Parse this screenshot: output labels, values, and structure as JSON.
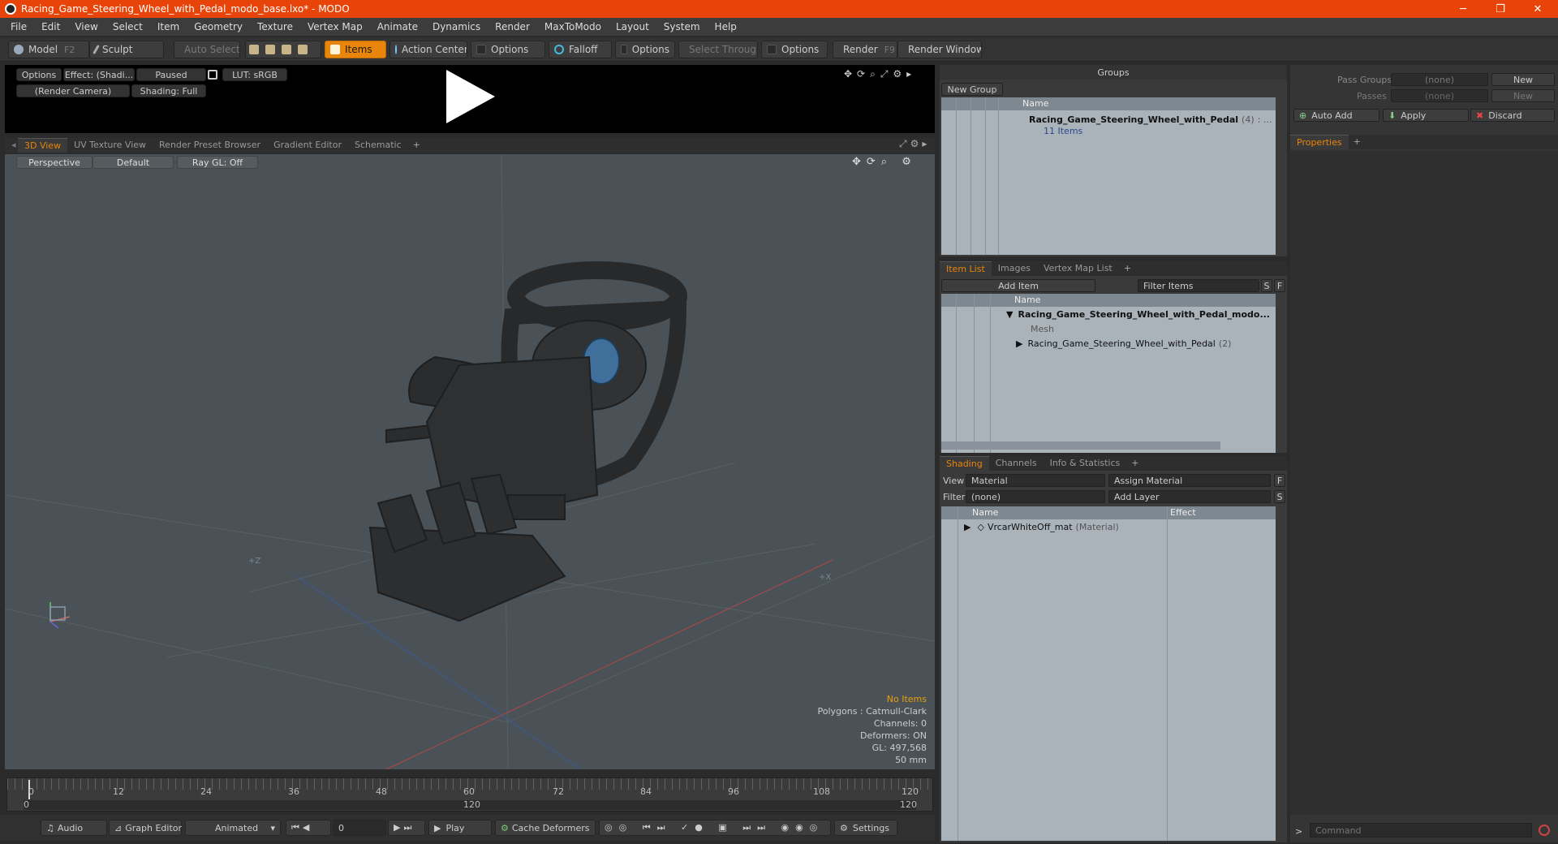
{
  "window": {
    "title": "Racing_Game_Steering_Wheel_with_Pedal_modo_base.lxo* - MODO",
    "minimize": "─",
    "maximize": "❐",
    "close": "✕"
  },
  "menu": [
    "File",
    "Edit",
    "View",
    "Select",
    "Item",
    "Geometry",
    "Texture",
    "Vertex Map",
    "Animate",
    "Dynamics",
    "Render",
    "MaxToModo",
    "Layout",
    "System",
    "Help"
  ],
  "toolbar": {
    "model": "Model",
    "model_key": "F2",
    "sculpt": "Sculpt",
    "auto_select": "Auto Select",
    "items": "Items",
    "action_center": "Action Center",
    "options1": "Options",
    "falloff": "Falloff",
    "options2": "Options",
    "select_through": "Select Through",
    "options3": "Options",
    "render": "Render",
    "render_key": "F9",
    "render_window": "Render Window"
  },
  "preview": {
    "options": "Options",
    "effect": "Effect: (Shadi...",
    "paused": "Paused",
    "lut": "LUT: sRGB",
    "camera": "(Render Camera)",
    "shading": "Shading: Full"
  },
  "view_tabs": [
    "3D View",
    "UV Texture View",
    "Render Preset Browser",
    "Gradient Editor",
    "Schematic",
    "+"
  ],
  "viewport": {
    "perspective": "Perspective",
    "default": "Default",
    "raygl": "Ray GL: Off",
    "stats": {
      "no_items": "No Items",
      "polygons": "Polygons : Catmull-Clark",
      "channels": "Channels: 0",
      "deformers": "Deformers: ON",
      "gl": "GL: 497,568",
      "lens": "50 mm"
    },
    "axis_pz": "+Z",
    "axis_px": "+X"
  },
  "timeline": {
    "ticks": [
      "0",
      "12",
      "24",
      "36",
      "48",
      "60",
      "72",
      "84",
      "96",
      "108",
      "120"
    ],
    "start": "0",
    "end_mid": "120",
    "end": "120"
  },
  "bottom": {
    "audio": "Audio",
    "graph_editor": "Graph Editor",
    "animated": "Animated",
    "frame": "0",
    "play": "Play",
    "cache": "Cache Deformers",
    "settings": "Settings"
  },
  "groups": {
    "title": "Groups",
    "new_group": "New Group",
    "col_name": "Name",
    "row_name": "Racing_Game_Steering_Wheel_with_Pedal",
    "row_count": "(4)",
    "row_ellipsis": ": ...",
    "row_items": "11 Items"
  },
  "item_list": {
    "tabs": [
      "Item List",
      "Images",
      "Vertex Map List",
      "+"
    ],
    "add_item": "Add Item",
    "filter": "Filter Items",
    "s": "S",
    "f": "F",
    "col_name": "Name",
    "rows": [
      {
        "name": "Racing_Game_Steering_Wheel_with_Pedal_modo..."
      },
      {
        "name": "Mesh"
      },
      {
        "name": "Racing_Game_Steering_Wheel_with_Pedal",
        "count": "(2)"
      }
    ]
  },
  "shading": {
    "tabs": [
      "Shading",
      "Channels",
      "Info & Statistics",
      "+"
    ],
    "view_label": "View",
    "view_value": "Material",
    "assign": "Assign Material",
    "f": "F",
    "filter_label": "Filter",
    "filter_value": "(none)",
    "add_layer": "Add Layer",
    "s": "S",
    "col_name": "Name",
    "col_effect": "Effect",
    "row_name": "VrcarWhiteOff_mat",
    "row_type": "(Material)"
  },
  "passes": {
    "pass_groups": "Pass Groups",
    "pass_groups_value": "(none)",
    "new1": "New",
    "passes": "Passes",
    "passes_value": "(none)",
    "new2": "New"
  },
  "actions": {
    "auto_add": "Auto Add",
    "apply": "Apply",
    "discard": "Discard"
  },
  "properties": {
    "tab": "Properties",
    "plus": "+"
  },
  "command": {
    "placeholder": "Command",
    "prompt": ">"
  }
}
